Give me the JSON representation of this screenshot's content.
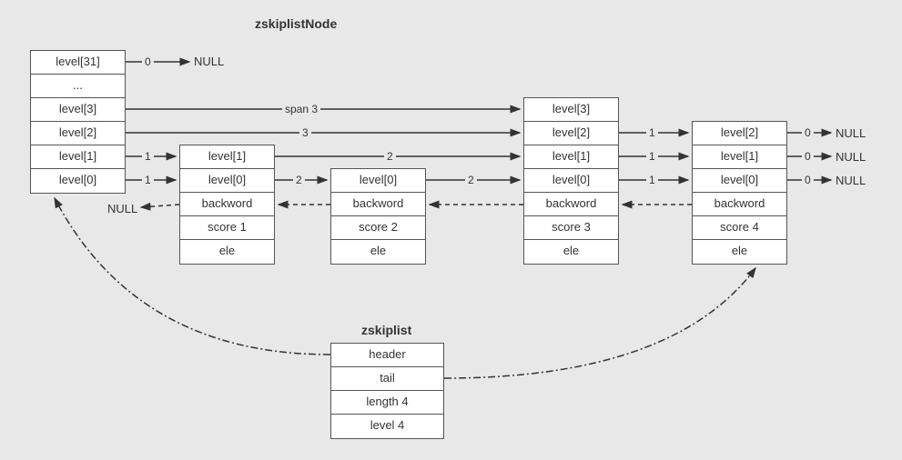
{
  "title_node": "zskiplistNode",
  "title_list": "zskiplist",
  "null_label": "NULL",
  "header_node": {
    "cells": [
      "level[31]",
      "...",
      "level[3]",
      "level[2]",
      "level[1]",
      "level[0]"
    ]
  },
  "node1": {
    "cells": [
      "level[1]",
      "level[0]",
      "backword",
      "score 1",
      "ele"
    ]
  },
  "node2": {
    "cells": [
      "level[0]",
      "backword",
      "score 2",
      "ele"
    ]
  },
  "node3": {
    "cells": [
      "level[3]",
      "level[2]",
      "level[1]",
      "level[0]",
      "backword",
      "score 3",
      "ele"
    ]
  },
  "node4": {
    "cells": [
      "level[2]",
      "level[1]",
      "level[0]",
      "backword",
      "score 4",
      "ele"
    ]
  },
  "zskiplist": {
    "cells": [
      "header",
      "tail",
      "length 4",
      "level 4"
    ]
  },
  "spans": {
    "h_l31": "0",
    "h_l3": "span 3",
    "h_l2": "3",
    "h_l1": "1",
    "h_l0": "1",
    "n1_l1": "2",
    "n1_l0": "2",
    "n2_l0": "2",
    "n3_l2": "1",
    "n3_l1": "1",
    "n3_l0": "1",
    "n4_l2": "0",
    "n4_l1": "0",
    "n4_l0": "0"
  }
}
